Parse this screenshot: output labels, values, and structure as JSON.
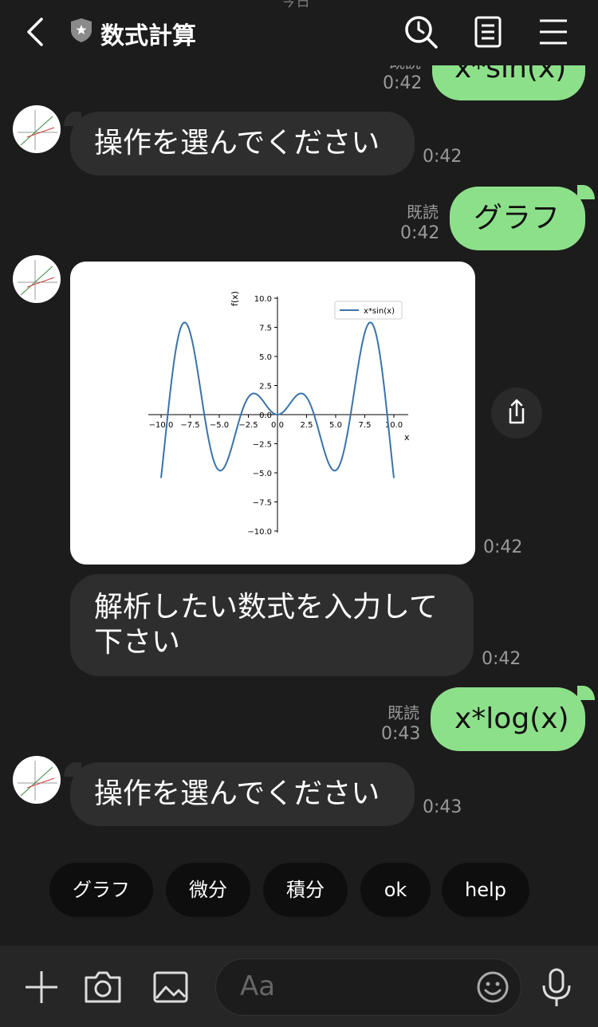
{
  "header": {
    "date_peek": "今日",
    "title": "数式計算"
  },
  "messages": {
    "m0": {
      "text": "x*sin(x)",
      "read": "既読",
      "time": "0:42"
    },
    "m1": {
      "text": "操作を選んでください",
      "time": "0:42"
    },
    "m2": {
      "text": "グラフ",
      "read": "既読",
      "time": "0:42"
    },
    "m3": {
      "time": "0:42"
    },
    "m4": {
      "line1": "解析したい数式を入力して",
      "line2": "下さい",
      "time": "0:42"
    },
    "m5": {
      "text": "x*log(x)",
      "read": "既読",
      "time": "0:43"
    },
    "m6": {
      "text": "操作を選んでください",
      "time": "0:43"
    }
  },
  "quick_replies": [
    "グラフ",
    "微分",
    "積分",
    "ok",
    "help"
  ],
  "input": {
    "placeholder": "Aa"
  },
  "colors": {
    "incoming_bubble": "#2e2e2e",
    "outgoing_bubble": "#8de08a",
    "background": "#1c1c1c"
  },
  "chart_data": {
    "type": "line",
    "function": "x*sin(x)",
    "x_domain": [
      -10,
      10
    ],
    "series": [
      {
        "name": "x*sin(x)"
      }
    ],
    "x_ticks": [
      "−10.0",
      "−7.5",
      "−5.0",
      "−2.5",
      "0.0",
      "2.5",
      "5.0",
      "7.5",
      "10.0"
    ],
    "y_ticks": [
      "10.0",
      "7.5",
      "5.0",
      "2.5",
      "0.0",
      "−2.5",
      "−5.0",
      "−7.5",
      "−10.0"
    ],
    "xlabel": "x",
    "ylabel": "f(x)",
    "xlim": [
      -11,
      11
    ],
    "ylim": [
      -10,
      10
    ],
    "legend": "top-right"
  }
}
